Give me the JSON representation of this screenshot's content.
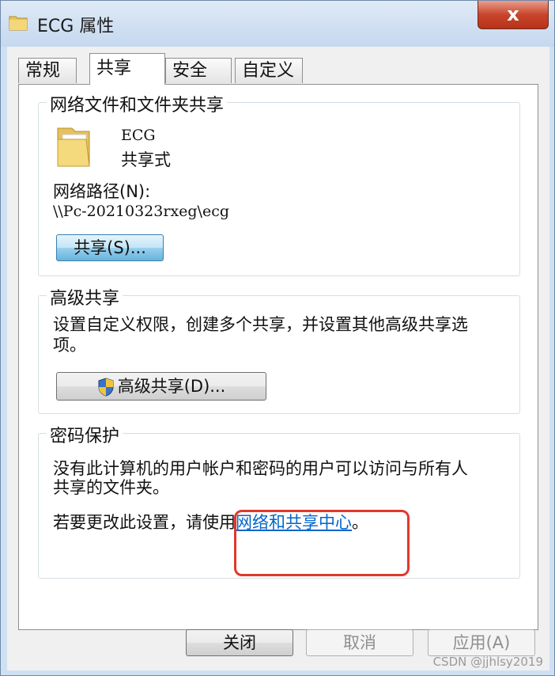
{
  "window": {
    "title": "ECG 属性",
    "close_label": "x"
  },
  "tabs": [
    {
      "label": "常规"
    },
    {
      "label": "共享"
    },
    {
      "label": "安全"
    },
    {
      "label": "自定义"
    }
  ],
  "network_sharing": {
    "group_title": "网络文件和文件夹共享",
    "folder_name": "ECG",
    "share_status": "共享式",
    "path_label": "网络路径(N):",
    "path_value": "\\\\Pc-20210323rxeg\\ecg",
    "share_button": "共享(S)..."
  },
  "advanced_sharing": {
    "group_title": "高级共享",
    "description_line1": "设置自定义权限，创建多个共享，并设置其他高级共享选",
    "description_line2": "项。",
    "button": "高级共享(D)..."
  },
  "password_protection": {
    "group_title": "密码保护",
    "line1": "没有此计算机的用户帐户和密码的用户可以访问与所有人",
    "line2": "共享的文件夹。",
    "change_prefix": "若要更改此设置，请使用",
    "link_text": "网络和共享中心",
    "change_suffix": "。"
  },
  "footer": {
    "close_button": "关闭",
    "cancel_button": "取消",
    "apply_button": "应用(A)"
  },
  "watermark": "CSDN @jjhlsy2019"
}
